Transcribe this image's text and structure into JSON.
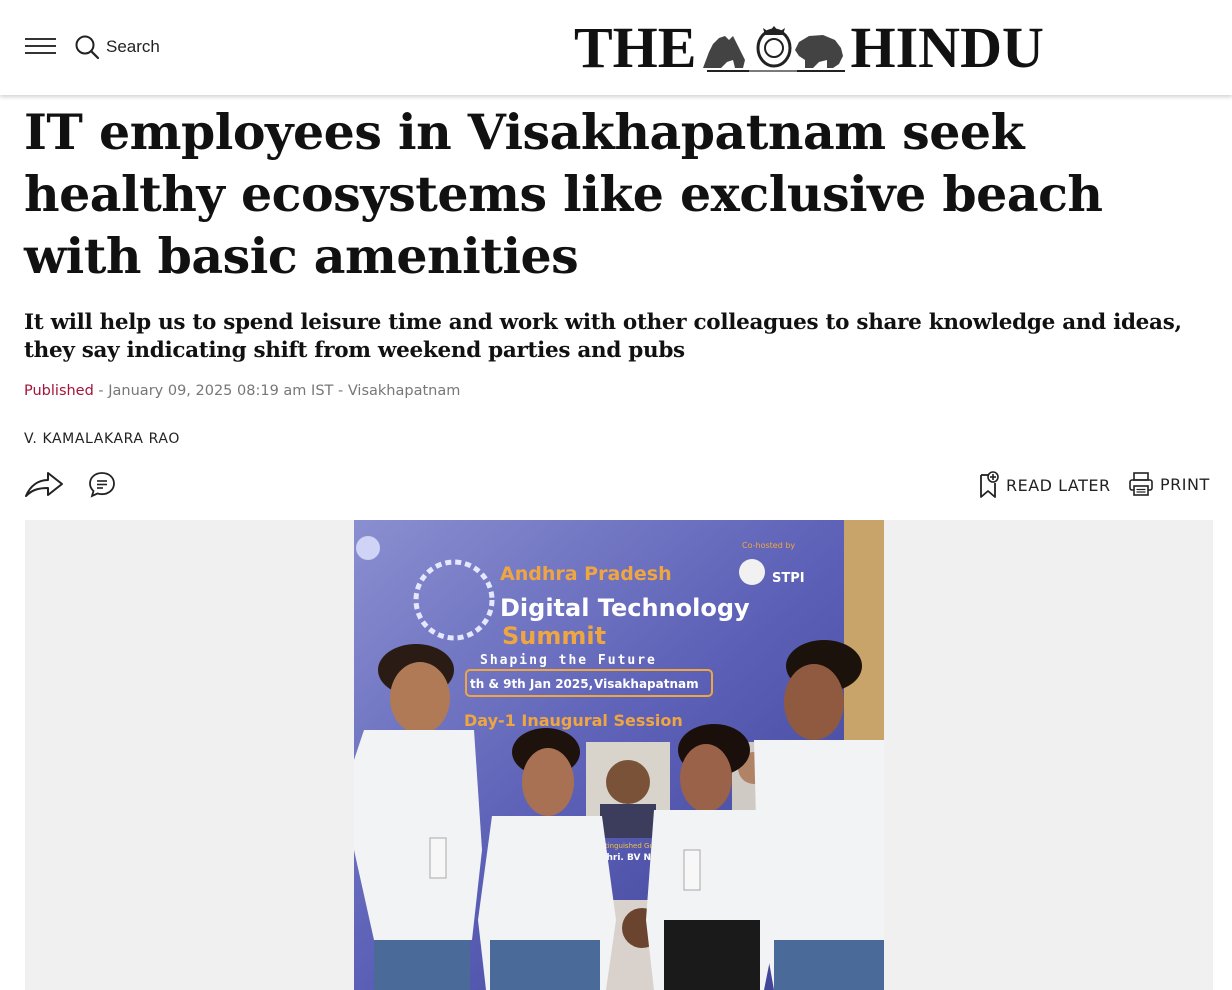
{
  "header": {
    "search_label": "Search",
    "masthead_left": "THE",
    "masthead_right": "HINDU",
    "menu_icon": "hamburger-menu-icon",
    "search_icon": "search-icon",
    "crest_icon": "hindu-crest-emblem"
  },
  "article": {
    "headline": "IT employees in Visakhapatnam seek healthy ecosystems like exclusive beach with basic amenities",
    "subheadline": "It will help us to spend leisure time and work with other colleagues to share knowledge and ideas, they say indicating shift from weekend parties and pubs",
    "published_label": "Published",
    "published_detail": " - January 09, 2025 08:19 am IST - Visakhapatnam",
    "author": "V. KAMALAKARA RAO"
  },
  "actions": {
    "share_icon": "share-icon",
    "comment_icon": "comment-icon",
    "read_later_label": "READ LATER",
    "read_later_icon": "bookmark-add-icon",
    "print_label": "PRINT",
    "print_icon": "printer-icon"
  },
  "photo": {
    "banner_line1": "Andhra Pradesh",
    "banner_line2": "Digital Technology",
    "banner_line3": "Summit",
    "tagline": "Shaping the Future",
    "dates": "th & 9th Jan 2025,",
    "venue": "Visakhapatnam",
    "session": "Day-1 Inaugural Session",
    "cohosted": "Co-hosted by",
    "stpi": "STPI",
    "guest_title": "Distinguished Guest",
    "guest_name": "Shri. BV Naidu",
    "colors": {
      "banner_bg": "#5b5fb6",
      "banner_text": "#f0a640",
      "shirt": "#f2f3f5",
      "jeans": "#4a6b9a"
    }
  },
  "colors": {
    "published": "#a5123a",
    "meta": "#777777",
    "image_band": "#f0f0f0"
  }
}
